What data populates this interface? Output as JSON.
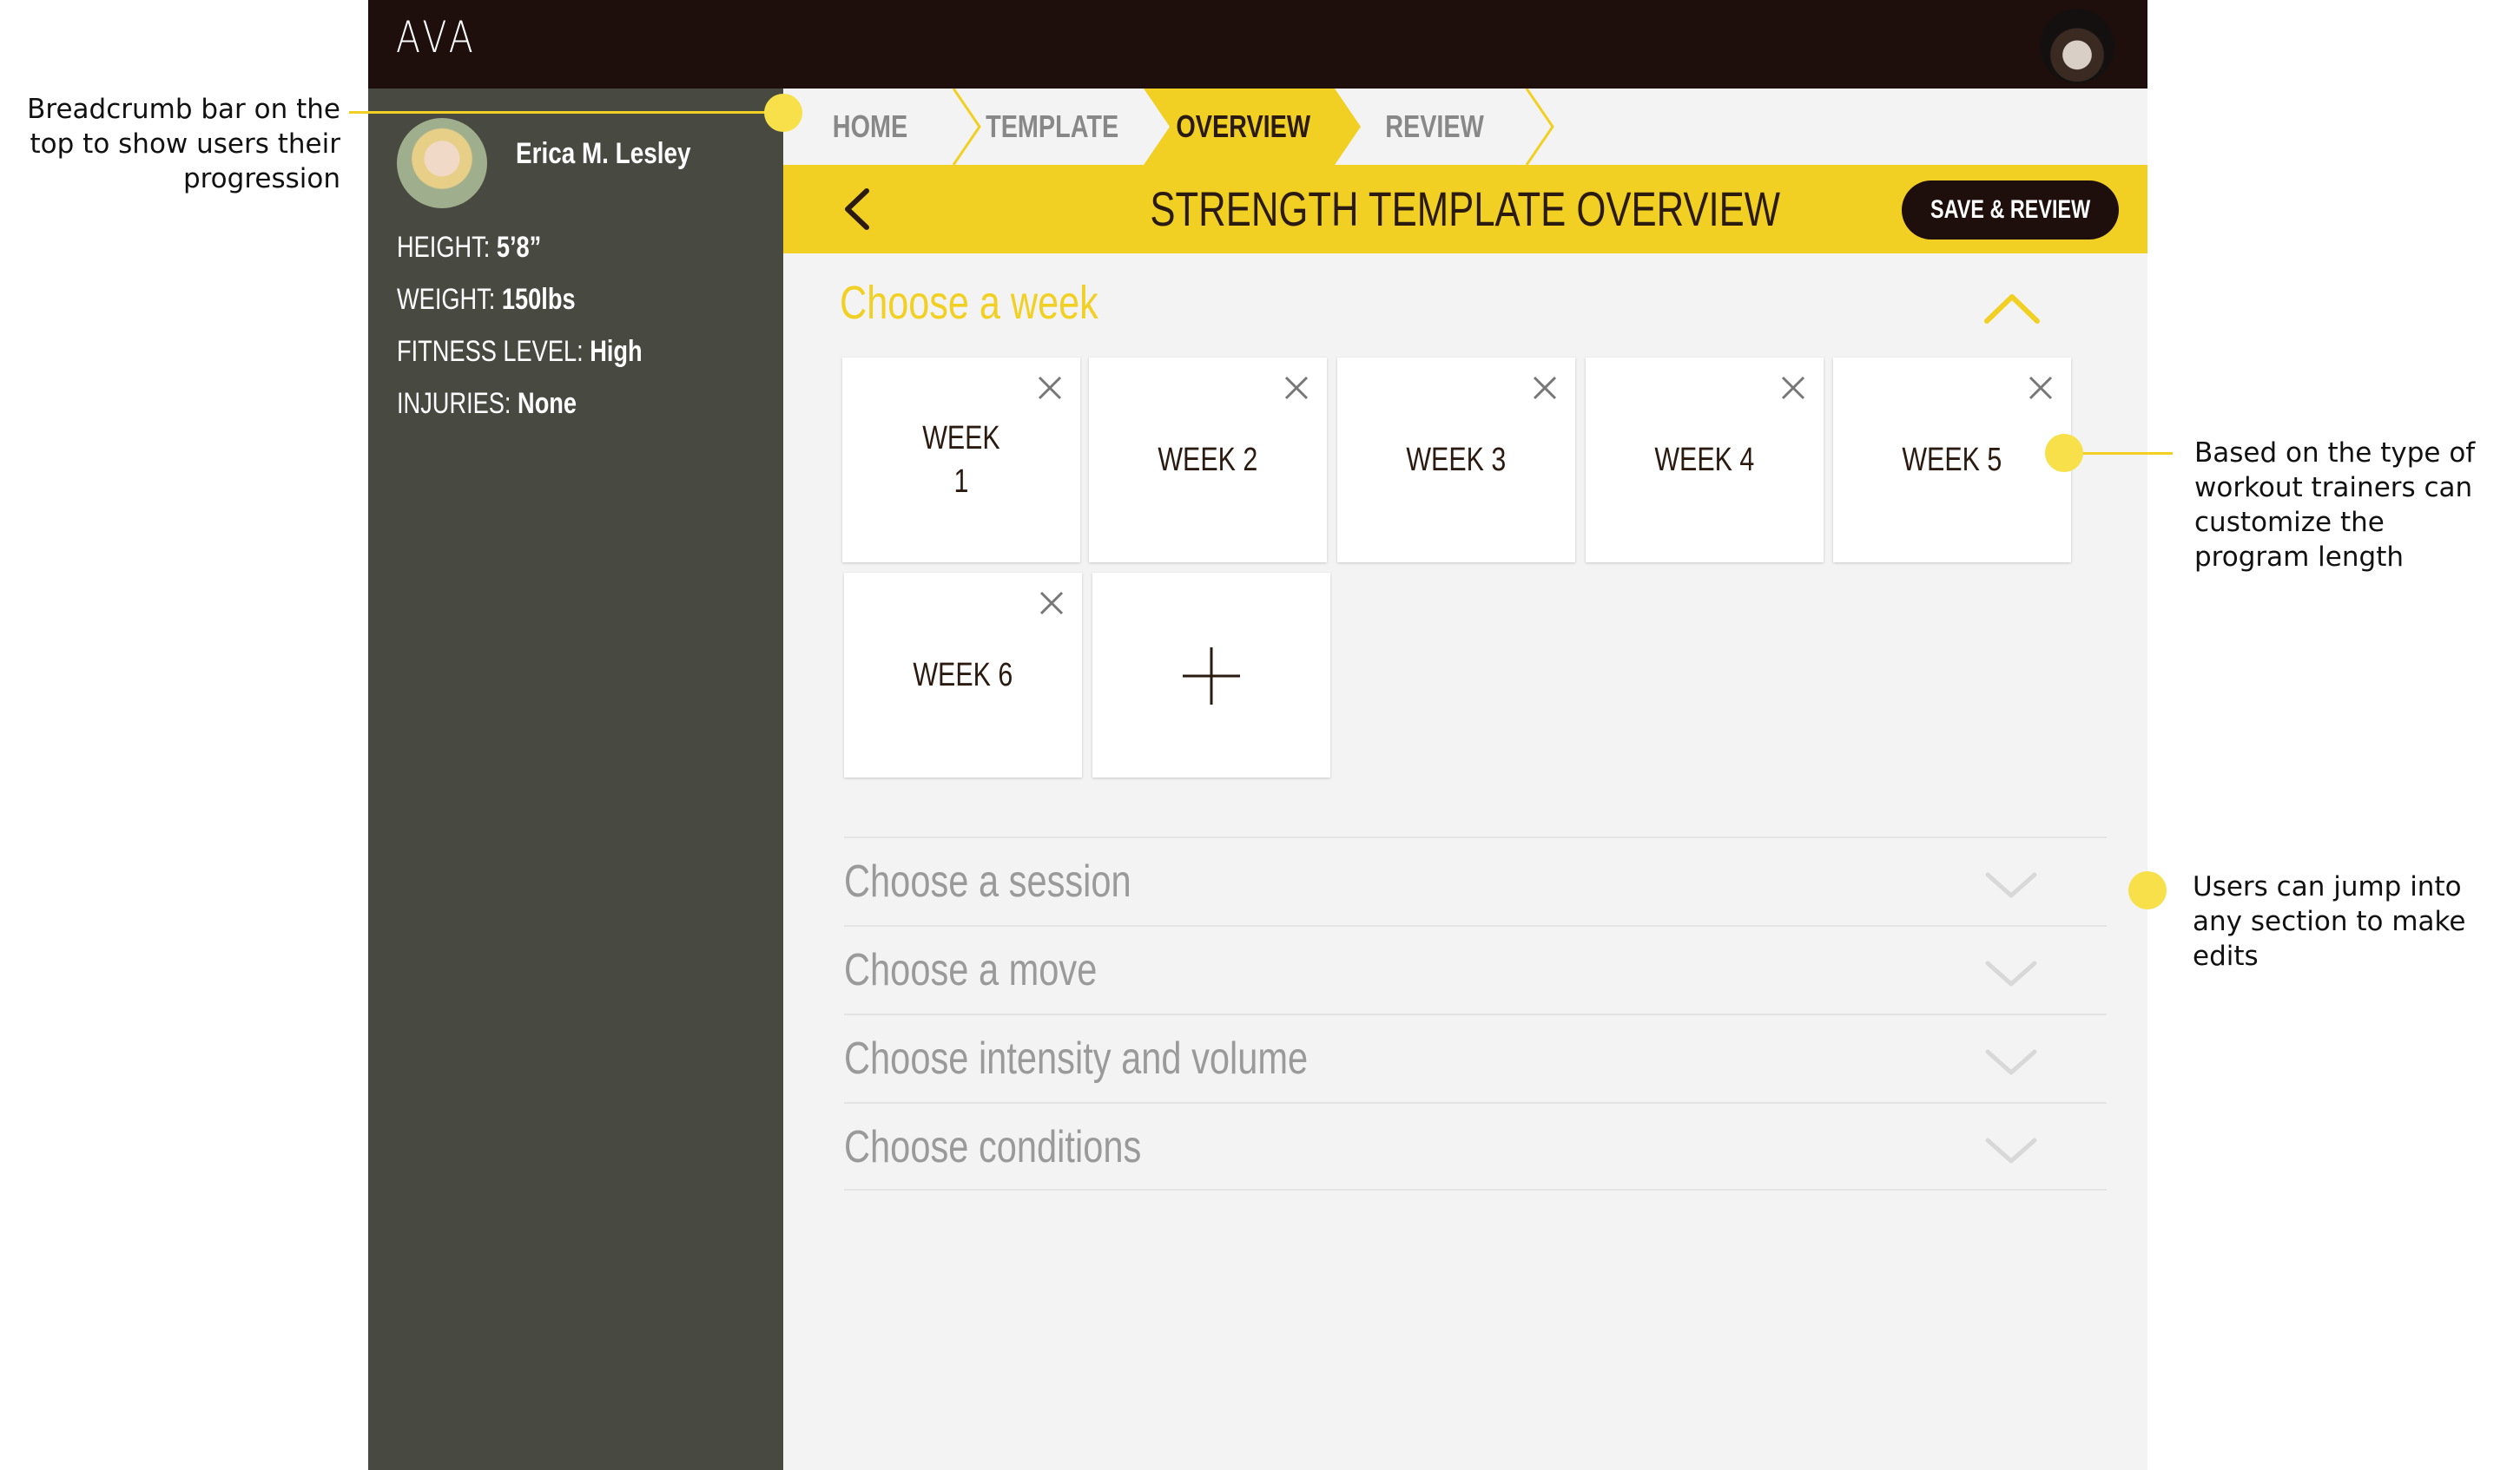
{
  "app": {
    "logo": "AVA"
  },
  "client": {
    "name": "Erica M. Lesley",
    "stats": [
      {
        "key": "HEIGHT:",
        "value": "5’8”"
      },
      {
        "key": "WEIGHT:",
        "value": "150lbs"
      },
      {
        "key": "FITNESS LEVEL:",
        "value": "High"
      },
      {
        "key": "INJURIES:",
        "value": "None"
      }
    ]
  },
  "breadcrumb": {
    "items": [
      "HOME",
      "TEMPLATE",
      "OVERVIEW",
      "REVIEW"
    ],
    "active": "OVERVIEW"
  },
  "header": {
    "title": "STRENGTH TEMPLATE OVERVIEW",
    "save_label": "SAVE & REVIEW"
  },
  "week_section": {
    "title": "Choose a week",
    "weeks": [
      "WEEK\n1",
      "WEEK 2",
      "WEEK 3",
      "WEEK 4",
      "WEEK 5",
      "WEEK 6"
    ]
  },
  "sections": [
    "Choose a session",
    "Choose a move",
    "Choose intensity and volume",
    "Choose conditions"
  ],
  "annotations": {
    "breadcrumb": "Breadcrumb bar on the top to show users their progression",
    "program_length": "Based on the type of workout trainers can customize the program length",
    "sections": "Users can jump into any section to make edits"
  },
  "colors": {
    "accent": "#f1d023",
    "topbar": "#1e0f0c",
    "sidebar": "#484941",
    "content": "#f3f3f3"
  },
  "icons": [
    "back-chevron-icon",
    "close-icon",
    "plus-icon",
    "chevron-up-icon",
    "chevron-down-icon"
  ]
}
